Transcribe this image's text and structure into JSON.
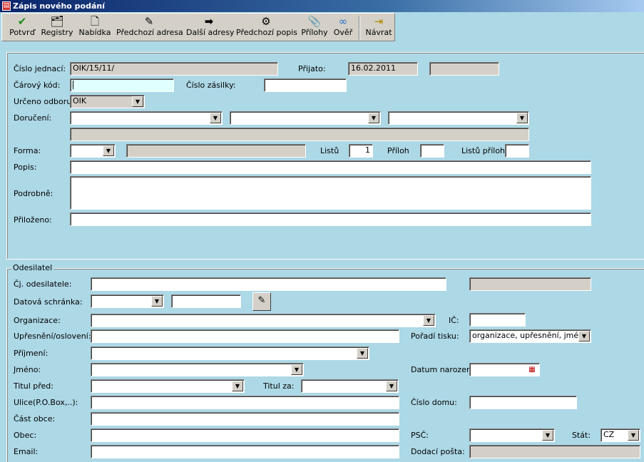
{
  "window": {
    "title": "Zápis nového podání"
  },
  "toolbar": {
    "items": [
      {
        "label": "Potvrď",
        "icon": "checkmark-icon"
      },
      {
        "label": "Registry",
        "icon": "registry-icon"
      },
      {
        "label": "Nabídka",
        "icon": "document-icon"
      },
      {
        "label": "Předchozí adresa",
        "icon": "pencil-icon"
      },
      {
        "label": "Další adresy",
        "icon": "arrow-right-icon"
      },
      {
        "label": "Předchozí popis",
        "icon": "gears-icon"
      },
      {
        "label": "Přílohy",
        "icon": "paperclip-icon"
      },
      {
        "label": "Ověř",
        "icon": "verify-icon"
      },
      {
        "label": "Návrat",
        "icon": "exit-door-icon"
      }
    ]
  },
  "main": {
    "cislo_jednaci": {
      "label": "Číslo jednací:",
      "value": "OIK/15/11/"
    },
    "prijato": {
      "label": "Přijato:",
      "value": "16.02.2011"
    },
    "carovy_kod": {
      "label": "Čárový kód:",
      "value": ""
    },
    "cislo_zasilky": {
      "label": "Číslo zásilky:",
      "value": ""
    },
    "urceno_odboru": {
      "label": "Určeno odboru:",
      "value": "OIK"
    },
    "doruceni": {
      "label": "Doručení:"
    },
    "forma": {
      "label": "Forma:"
    },
    "listu": {
      "label": "Listů",
      "value": "1"
    },
    "priloh": {
      "label": "Příloh"
    },
    "listu_priloh": {
      "label": "Listů příloh"
    },
    "popis": {
      "label": "Popis:"
    },
    "podrobne": {
      "label": "Podrobně:"
    },
    "prilozeno": {
      "label": "Přiloženo:"
    }
  },
  "sender": {
    "legend": "Odesilatel",
    "cj_odesilatele": "Čj. odesilatele:",
    "datova_schranka": "Datová schránka:",
    "organizace": "Organizace:",
    "ic": "IČ:",
    "upresneni": "Upřesnění/oslovení:",
    "poradi_tisku": {
      "label": "Pořadí tisku:",
      "value": "organizace, upřesnění, jméno"
    },
    "prijmeni": "Příjmení:",
    "jmeno": "Jméno:",
    "datum_narozeni": "Datum narození:",
    "titul_pred": "Titul před:",
    "titul_za": "Titul za:",
    "ulice": "Ulice(P.O.Box,..):",
    "cislo_domu": "Číslo domu:",
    "cast_obce": "Část obce:",
    "obec": "Obec:",
    "psc": "PSČ:",
    "stat": {
      "label": "Stát:",
      "value": "CZ"
    },
    "email": "Email:",
    "dodaci_posta": "Dodací pošta:"
  }
}
